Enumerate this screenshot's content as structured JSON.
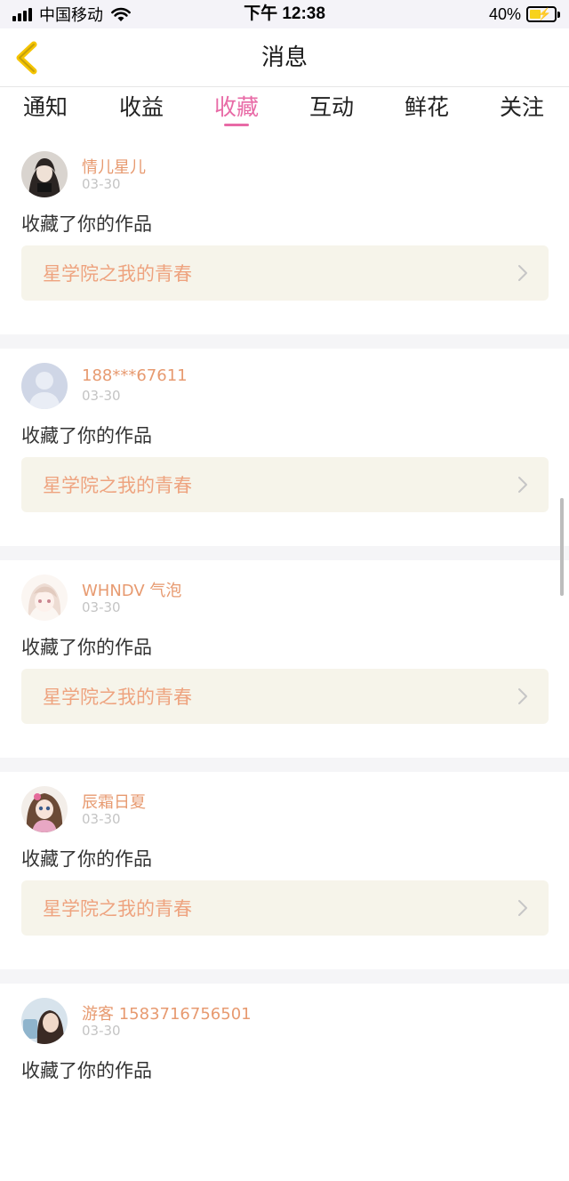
{
  "status_bar": {
    "carrier": "中国移动",
    "time": "下午 12:38",
    "battery": "40%",
    "battery_level": 0.4,
    "icons": [
      "signal-icon",
      "wifi-icon",
      "battery-charging-icon"
    ]
  },
  "header": {
    "title": "消息",
    "back_icon": "chevron-left-icon"
  },
  "tabs": [
    {
      "label": "通知"
    },
    {
      "label": "收益"
    },
    {
      "label": "收藏",
      "active": true
    },
    {
      "label": "互动"
    },
    {
      "label": "鲜花"
    },
    {
      "label": "关注"
    }
  ],
  "colors": {
    "accent": "#e86aa6",
    "username": "#e79a70",
    "work_title": "#eea37f",
    "work_box_bg": "#f6f4ea"
  },
  "messages": [
    {
      "user": "情儿星儿",
      "date": "03-30",
      "action": "收藏了你的作品",
      "work": "星学院之我的青春"
    },
    {
      "user": "188***67611",
      "date": "03-30",
      "action": "收藏了你的作品",
      "work": "星学院之我的青春"
    },
    {
      "user": "WHNDV 气泡",
      "date": "03-30",
      "action": "收藏了你的作品",
      "work": "星学院之我的青春"
    },
    {
      "user": "辰霜日夏",
      "date": "03-30",
      "action": "收藏了你的作品",
      "work": "星学院之我的青春"
    },
    {
      "user": "游客 1583716756501",
      "date": "03-30",
      "action": "收藏了你的作品",
      "work": ""
    }
  ]
}
